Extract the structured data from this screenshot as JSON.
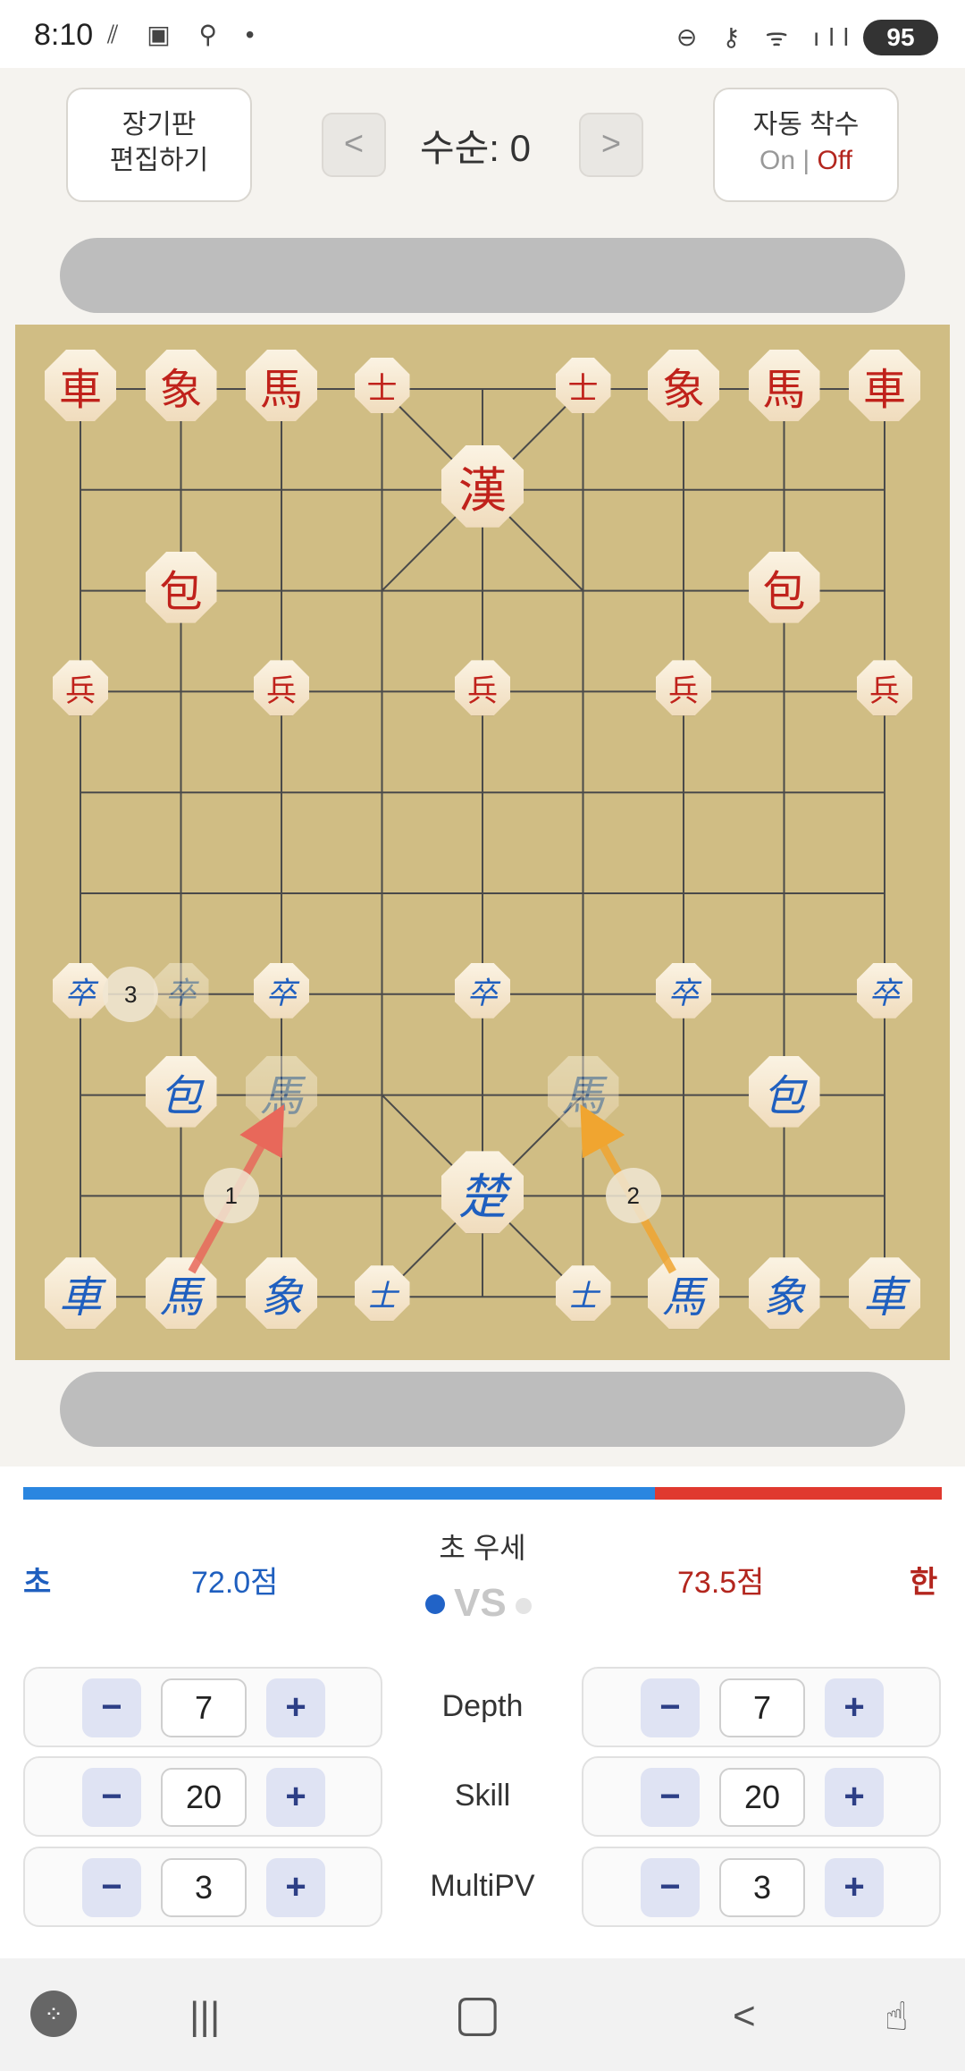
{
  "status_bar": {
    "time": "8:10",
    "left_icons": "⫽ ▣ ⚲ •",
    "right_icons": "⊖ ⚷ ᯤ ıll",
    "battery": "95"
  },
  "header": {
    "edit_board_line1": "장기판",
    "edit_board_line2": "편집하기",
    "prev_icon": "<",
    "next_icon": ">",
    "move_counter": "수순: 0",
    "auto_move_label": "자동 착수",
    "auto_on": "On",
    "auto_sep": "|",
    "auto_off": "Off"
  },
  "board": {
    "red_pieces": [
      {
        "char": "車",
        "col": 0,
        "row": 0,
        "size": "big"
      },
      {
        "char": "象",
        "col": 1,
        "row": 0,
        "size": "big"
      },
      {
        "char": "馬",
        "col": 2,
        "row": 0,
        "size": "big"
      },
      {
        "char": "士",
        "col": 3,
        "row": 0,
        "size": "small"
      },
      {
        "char": "士",
        "col": 5,
        "row": 0,
        "size": "small"
      },
      {
        "char": "象",
        "col": 6,
        "row": 0,
        "size": "big"
      },
      {
        "char": "馬",
        "col": 7,
        "row": 0,
        "size": "big"
      },
      {
        "char": "車",
        "col": 8,
        "row": 0,
        "size": "big"
      },
      {
        "char": "漢",
        "col": 4,
        "row": 1,
        "size": "king"
      },
      {
        "char": "包",
        "col": 1,
        "row": 2,
        "size": "big"
      },
      {
        "char": "包",
        "col": 7,
        "row": 2,
        "size": "big"
      },
      {
        "char": "兵",
        "col": 0,
        "row": 3,
        "size": "small"
      },
      {
        "char": "兵",
        "col": 2,
        "row": 3,
        "size": "small"
      },
      {
        "char": "兵",
        "col": 4,
        "row": 3,
        "size": "small"
      },
      {
        "char": "兵",
        "col": 6,
        "row": 3,
        "size": "small"
      },
      {
        "char": "兵",
        "col": 8,
        "row": 3,
        "size": "small"
      }
    ],
    "blue_pieces": [
      {
        "char": "卒",
        "col": 0,
        "row": 6,
        "size": "small"
      },
      {
        "char": "卒",
        "col": 2,
        "row": 6,
        "size": "small"
      },
      {
        "char": "卒",
        "col": 4,
        "row": 6,
        "size": "small"
      },
      {
        "char": "卒",
        "col": 6,
        "row": 6,
        "size": "small"
      },
      {
        "char": "卒",
        "col": 8,
        "row": 6,
        "size": "small"
      },
      {
        "char": "包",
        "col": 1,
        "row": 7,
        "size": "big"
      },
      {
        "char": "包",
        "col": 7,
        "row": 7,
        "size": "big"
      },
      {
        "char": "楚",
        "col": 4,
        "row": 8,
        "size": "king"
      },
      {
        "char": "車",
        "col": 0,
        "row": 9,
        "size": "big"
      },
      {
        "char": "馬",
        "col": 1,
        "row": 9,
        "size": "big"
      },
      {
        "char": "象",
        "col": 2,
        "row": 9,
        "size": "big"
      },
      {
        "char": "士",
        "col": 3,
        "row": 9,
        "size": "small"
      },
      {
        "char": "士",
        "col": 5,
        "row": 9,
        "size": "small"
      },
      {
        "char": "馬",
        "col": 6,
        "row": 9,
        "size": "big"
      },
      {
        "char": "象",
        "col": 7,
        "row": 9,
        "size": "big"
      },
      {
        "char": "車",
        "col": 8,
        "row": 9,
        "size": "big"
      }
    ],
    "ghost_pieces": [
      {
        "char": "卒",
        "col": 1,
        "row": 6,
        "size": "small"
      },
      {
        "char": "馬",
        "col": 2,
        "row": 7,
        "size": "big"
      },
      {
        "char": "馬",
        "col": 5,
        "row": 7,
        "size": "big"
      }
    ],
    "hint_badges": [
      {
        "label": "1",
        "col": 1.5,
        "row": 8
      },
      {
        "label": "2",
        "col": 5.5,
        "row": 8
      },
      {
        "label": "3",
        "col": 0.5,
        "row": 6
      }
    ],
    "hint_arrows": [
      {
        "from": [
          1,
          9
        ],
        "to": [
          2,
          7
        ],
        "color": "#e8685a"
      },
      {
        "from": [
          6,
          9
        ],
        "to": [
          5,
          7
        ],
        "color": "#f0a530"
      }
    ]
  },
  "evaluation": {
    "cho_label": "초",
    "cho_score": "72.0점",
    "advantage": "초 우세",
    "vs": "VS",
    "han_score": "73.5점",
    "han_label": "한",
    "blue_fraction": 0.688
  },
  "engine_settings": {
    "minus": "−",
    "plus": "+",
    "rows": [
      {
        "label": "Depth",
        "cho": "7",
        "han": "7"
      },
      {
        "label": "Skill",
        "cho": "20",
        "han": "20"
      },
      {
        "label": "MultiPV",
        "cho": "3",
        "han": "3"
      }
    ]
  },
  "nav_bar": {
    "game_icon": "🎮",
    "recents_icon": "|||",
    "home_icon": "▢",
    "back_icon": "<",
    "assist_icon": "☝"
  },
  "colors": {
    "board": "#d0bd84",
    "red_piece": "#c0221b",
    "blue_piece": "#1f5fbf",
    "blue_bar": "#2a86e0",
    "red_bar": "#e0392f"
  }
}
